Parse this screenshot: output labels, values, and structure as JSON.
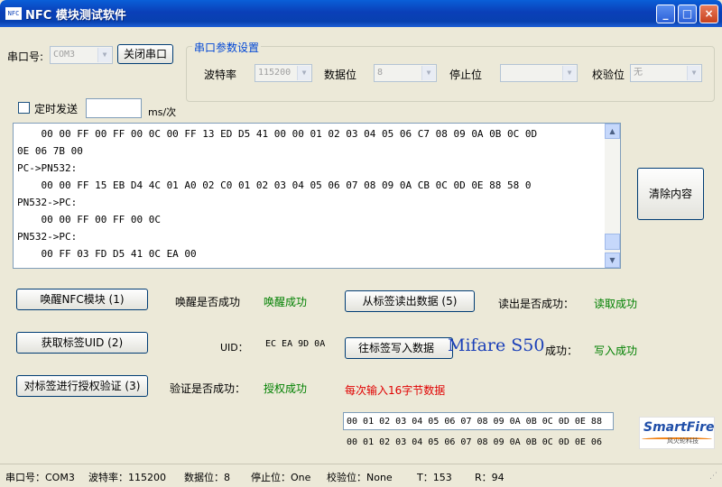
{
  "window": {
    "title": "NFC 模块测试软件",
    "icon": "NFC"
  },
  "serial": {
    "port_label": "串口号:",
    "port_value": "COM3",
    "close_button": "关闭串口",
    "group_title": "串口参数设置",
    "baud_label": "波特率",
    "baud_value": "115200",
    "databits_label": "数据位",
    "databits_value": "8",
    "stopbits_label": "停止位",
    "stopbits_value": "",
    "parity_label": "校验位",
    "parity_value": "无"
  },
  "timer": {
    "label": "定时发送",
    "value": "",
    "unit": "ms/次"
  },
  "log": {
    "lines": [
      "    00 00 FF 00 FF 00 0C 00 FF 13 ED D5 41 00 00 01 02 03 04 05 06 C7 08 09 0A 0B 0C 0D",
      "0E 06 7B 00",
      "PC->PN532:",
      "    00 00 FF 15 EB D4 4C 01 A0 02 C0 01 02 03 04 05 06 07 08 09 0A CB 0C 0D 0E 88 58 0",
      "PN532->PC:",
      "    00 00 FF 00 FF 00 0C",
      "PN532->PC:",
      "    00 FF 03 FD D5 41 0C EA 00"
    ]
  },
  "clear_button": "清除内容",
  "actions": {
    "wake_button": "唤醒NFC模块 (1)",
    "wake_label": "唤醒是否成功",
    "wake_status": "唤醒成功",
    "read_button": "从标签读出数据 (5)",
    "read_label": "读出是否成功：",
    "read_status": "读取成功",
    "uid_button": "获取标签UID (2)",
    "uid_label": "UID：",
    "uid_value": "EC EA 9D 0A",
    "write_button": "往标签写入数据",
    "write_overlay": "Mifare S50",
    "write_label": "成功：",
    "write_status": "写入成功",
    "auth_button": "对标签进行授权验证 (3)",
    "auth_label": "验证是否成功：",
    "auth_status": "授权成功",
    "hint": "每次输入16字节数据",
    "write_input": "00 01 02 03 04 05 06 07 08 09 0A 0B 0C 0D 0E 88",
    "read_data": "00 01 02 03 04 05 06 07 08 09 0A 0B 0C 0D 0E 06"
  },
  "logo": {
    "text": "SmartFire",
    "sub": "风火轮科技"
  },
  "statusbar": {
    "port": "串口号：COM3",
    "baud": "波特率：115200",
    "databits": "数据位：8",
    "stopbits": "停止位：One",
    "parity": "校验位：None",
    "t": "T：153",
    "r": "R：94"
  },
  "colors": {
    "titlebar": "#0a3fb8",
    "success": "#008000",
    "hint": "#e00000",
    "group_title": "#0046d5"
  }
}
